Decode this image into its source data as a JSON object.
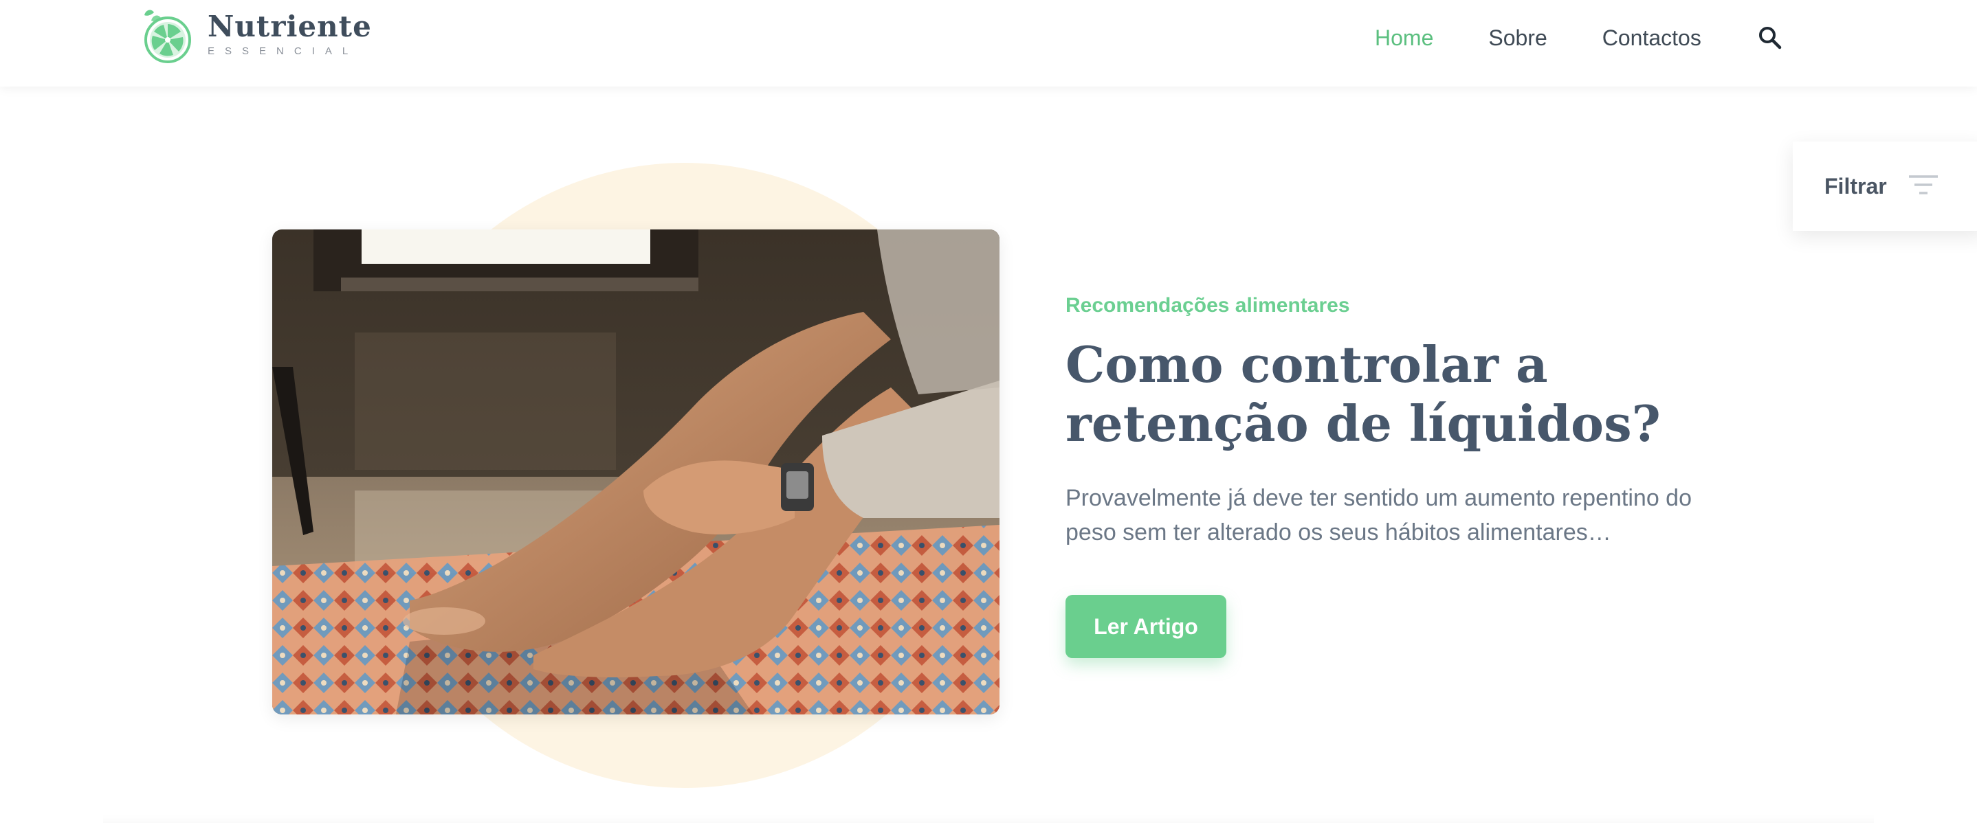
{
  "brand": {
    "name": "Nutriente",
    "tagline": "ESSENCIAL",
    "accent_color": "#6acf8e"
  },
  "nav": {
    "items": [
      {
        "label": "Home",
        "active": true
      },
      {
        "label": "Sobre",
        "active": false
      },
      {
        "label": "Contactos",
        "active": false
      }
    ],
    "search_icon": "search-icon"
  },
  "filter": {
    "label": "Filtrar",
    "icon": "filter-lines-icon"
  },
  "featured": {
    "category": "Recomendações alimentares",
    "title": "Como controlar a retenção de líquidos?",
    "excerpt": "Provavelmente já deve ter sentido um aumento repentino do peso sem ter alterado os seus hábitos alimentares…",
    "button_label": "Ler Artigo"
  }
}
